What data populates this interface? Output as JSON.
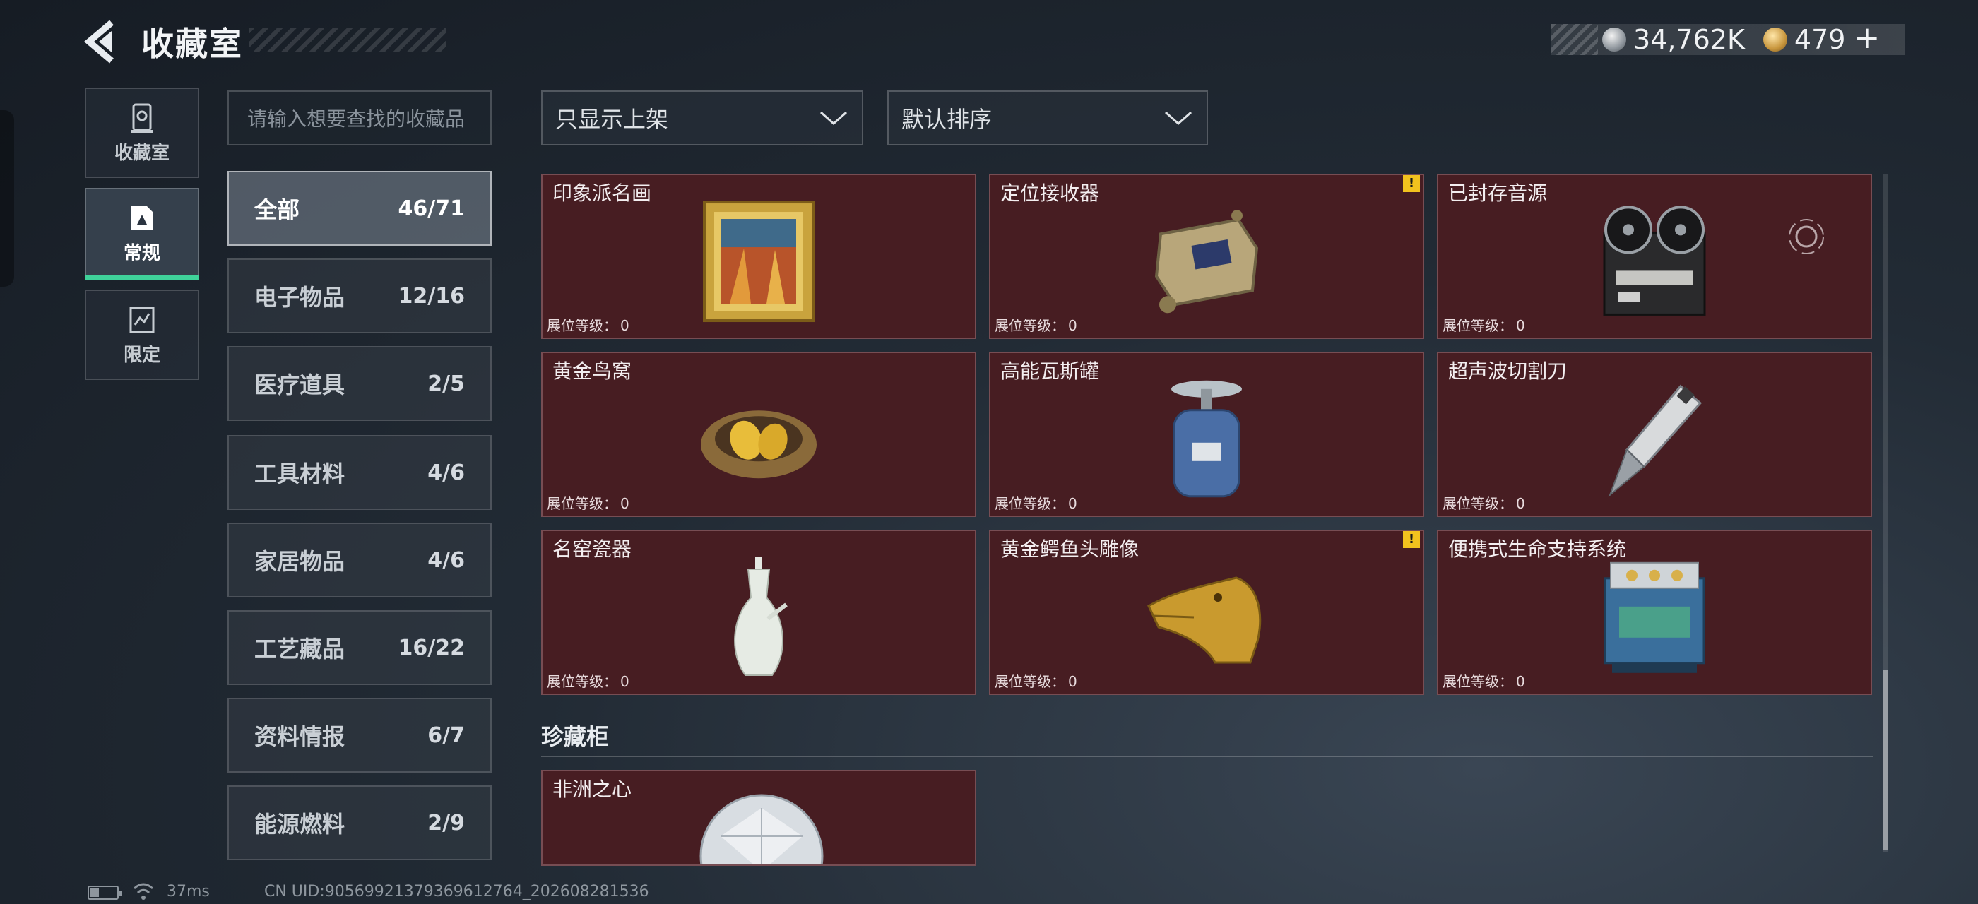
{
  "header": {
    "title": "收藏室",
    "currencies": [
      {
        "icon": "silver-coin-icon",
        "value": "34,762K"
      },
      {
        "icon": "gold-coin-icon",
        "value": "479"
      }
    ],
    "add_label": "+"
  },
  "side_tabs": [
    {
      "label": "收藏室",
      "icon": "collection-room-icon"
    },
    {
      "label": "常规",
      "icon": "regular-icon",
      "active": true
    },
    {
      "label": "限定",
      "icon": "limited-icon"
    }
  ],
  "search": {
    "placeholder": "请输入想要查找的收藏品"
  },
  "categories": [
    {
      "name": "全部",
      "count": "46/71",
      "active": true
    },
    {
      "name": "电子物品",
      "count": "12/16"
    },
    {
      "name": "医疗道具",
      "count": "2/5"
    },
    {
      "name": "工具材料",
      "count": "4/6"
    },
    {
      "name": "家居物品",
      "count": "4/6"
    },
    {
      "name": "工艺藏品",
      "count": "16/22"
    },
    {
      "name": "资料情报",
      "count": "6/7"
    },
    {
      "name": "能源燃料",
      "count": "2/9"
    }
  ],
  "filters": {
    "display": "只显示上架",
    "sort": "默认排序"
  },
  "level_label": "展位等级：",
  "items": [
    {
      "name": "印象派名画",
      "level": "0",
      "icon": "framed-painting-icon"
    },
    {
      "name": "定位接收器",
      "level": "0",
      "icon": "receiver-device-icon",
      "warning": "!"
    },
    {
      "name": "已封存音源",
      "level": "0",
      "icon": "reel-tape-recorder-icon"
    },
    {
      "name": "黄金鸟窝",
      "level": "0",
      "icon": "golden-nest-icon"
    },
    {
      "name": "高能瓦斯罐",
      "level": "0",
      "icon": "gas-canister-icon"
    },
    {
      "name": "超声波切割刀",
      "level": "0",
      "icon": "ultrasonic-knife-icon"
    },
    {
      "name": "名窑瓷器",
      "level": "0",
      "icon": "porcelain-vase-icon"
    },
    {
      "name": "黄金鳄鱼头雕像",
      "level": "0",
      "icon": "gold-crocodile-statue-icon",
      "warning": "!"
    },
    {
      "name": "便携式生命支持系统",
      "level": "0",
      "icon": "life-support-system-icon"
    }
  ],
  "showcase": {
    "title": "珍藏柜",
    "items": [
      {
        "name": "非洲之心",
        "icon": "diamond-icon"
      }
    ]
  },
  "status_bar": {
    "ping": "37ms",
    "uid": "CN UID:9056992137936961276​4_202608281536"
  }
}
